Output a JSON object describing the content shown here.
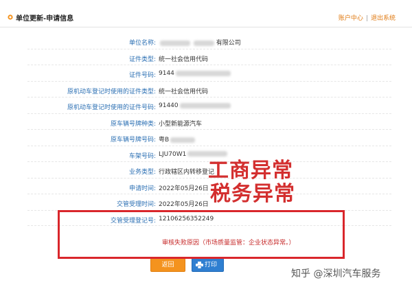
{
  "header": {
    "title": "单位更新-申请信息",
    "links": {
      "account": "账户中心",
      "separator": "|",
      "logout": "退出系统"
    }
  },
  "rows": [
    {
      "label": "单位名称:",
      "value": "有限公司"
    },
    {
      "label": "证件类型:",
      "value": "统一社会信用代码"
    },
    {
      "label": "证件号码:",
      "value": "9144"
    },
    {
      "label": "原机动车登记时使用的证件类型:",
      "value": "统一社会信用代码"
    },
    {
      "label": "原机动车登记时使用的证件号码:",
      "value": "91440"
    },
    {
      "label": "原车辆号牌种类:",
      "value": "小型新能源汽车"
    },
    {
      "label": "原车辆号牌号码:",
      "value": "粤B"
    },
    {
      "label": "车架号码:",
      "value": "LJU70W1"
    },
    {
      "label": "业务类型:",
      "value": "行政辖区内转移登记"
    },
    {
      "label": "申请时间:",
      "value": "2022年05月26日"
    },
    {
      "label": "交管受理时间:",
      "value": "2022年05月26日"
    },
    {
      "label": "交管受理登记号:",
      "value": "12106256352249"
    }
  ],
  "failure": {
    "text": "审核失败原因（市场质量监管：企业状态异常。）"
  },
  "buttons": {
    "back": "返回",
    "print": "打印"
  },
  "overlay": {
    "line1": "工商异常",
    "line2": "税务异常"
  },
  "watermark": "知乎 @深圳汽车服务",
  "colors": {
    "accent": "#e07a12",
    "label_blue": "#2b6fb3",
    "alert_red": "#d32f2f",
    "print_blue": "#2f7fd1",
    "back_orange": "#f4931e"
  },
  "icons": {
    "title_dot": "orange-dot-icon",
    "print": "printer-icon"
  }
}
